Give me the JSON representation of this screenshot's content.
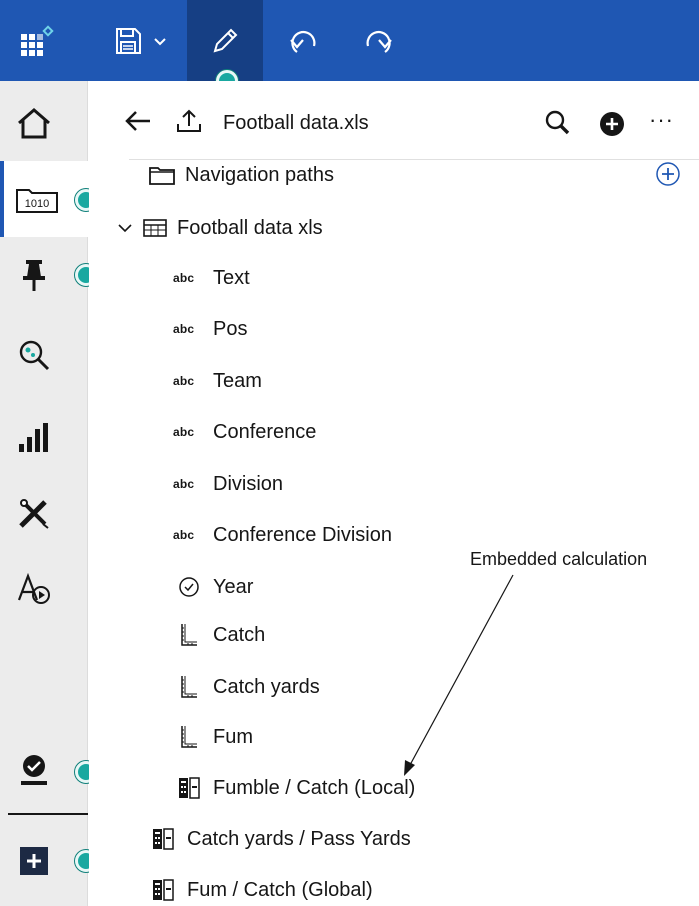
{
  "toolbar": {
    "icons": [
      "app-logo-icon",
      "save-icon",
      "chevron-down-icon",
      "edit-pencil-icon",
      "undo-icon",
      "redo-icon"
    ]
  },
  "rail": {
    "items": [
      "home-icon",
      "data-source-icon",
      "pin-icon",
      "explore-icon",
      "visualizations-icon",
      "navigation-tools-icon",
      "assistant-icon",
      "account-icon",
      "add-icon"
    ]
  },
  "panel": {
    "title": "Football data.xls",
    "more_label": "···",
    "navigation_paths": "Navigation paths",
    "table_name": "Football data xls",
    "abc_label": "abc",
    "fields": [
      {
        "label": "Text",
        "kind": "text"
      },
      {
        "label": "Pos",
        "kind": "text"
      },
      {
        "label": "Team",
        "kind": "text"
      },
      {
        "label": "Conference",
        "kind": "text"
      },
      {
        "label": "Division",
        "kind": "text"
      },
      {
        "label": "Conference Division",
        "kind": "text"
      },
      {
        "label": "Year",
        "kind": "time"
      },
      {
        "label": "Catch",
        "kind": "measure"
      },
      {
        "label": "Catch yards",
        "kind": "measure"
      },
      {
        "label": "Fum",
        "kind": "measure"
      },
      {
        "label": "Fumble / Catch (Local)",
        "kind": "calculation"
      }
    ],
    "calculations": [
      {
        "label": "Catch yards / Pass Yards"
      },
      {
        "label": "Fum / Catch (Global)"
      }
    ]
  },
  "annotation": {
    "text": "Embedded calculation"
  },
  "colors": {
    "topbar": "#1f57b3",
    "topbar_active": "#163f84",
    "marker": "#19a8a0",
    "rail": "#ececec"
  }
}
